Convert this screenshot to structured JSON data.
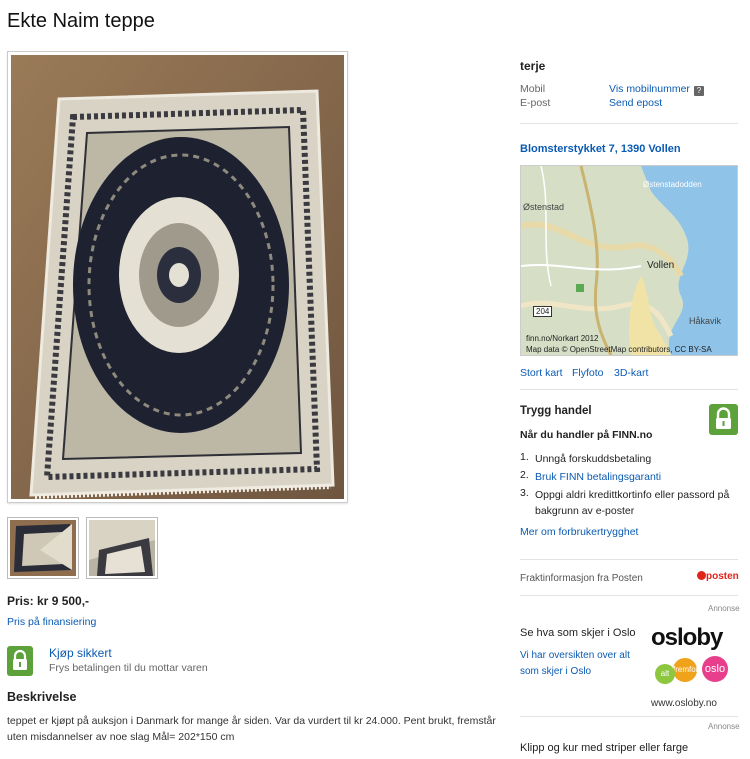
{
  "listing": {
    "title": "Ekte Naim teppe",
    "price": "Pris: kr 9 500,-",
    "financing_link": "Pris på finansiering",
    "buy_safe": {
      "title": "Kjøp sikkert",
      "subtitle": "Frys betalingen til du mottar varen"
    },
    "description_heading": "Beskrivelse",
    "description": "teppet er kjøpt på auksjon i Danmark for mange år siden. Var da vurdert til kr 24.000. Pent brukt, fremstår uten misdannelser av noe slag Mål= 202*150 cm"
  },
  "seller": {
    "name": "terje",
    "mobile_label": "Mobil",
    "mobile_link": "Vis mobilnummer",
    "email_label": "E-post",
    "email_link": "Send epost"
  },
  "location": {
    "address": "Blomsterstykket 7, 1390 Vollen",
    "map_labels": [
      "Østenstadodden",
      "Østenstad",
      "Vollen",
      "Håkavik",
      "204"
    ],
    "attribution_1": "finn.no/Norkart 2012",
    "attribution_2": "Map data © OpenStreetMap contributors, CC BY-SA",
    "links": [
      "Stort kart",
      "Flyfoto",
      "3D-kart"
    ]
  },
  "safe_trade": {
    "heading": "Trygg handel",
    "subheading": "Når du handler på FINN.no",
    "items": [
      {
        "num": "1.",
        "text": "Unngå forskuddsbetaling"
      },
      {
        "num": "2.",
        "text": "Bruk FINN betalingsgaranti"
      },
      {
        "num": "3.",
        "text": "Oppgi aldri kredittkortinfo eller passord på bakgrunn av e-poster"
      }
    ],
    "consumer_link": "Mer om forbrukertrygghet"
  },
  "freight": {
    "text": "Fraktinformasjon fra Posten",
    "logo": "posten"
  },
  "ads": {
    "label": "Annonse",
    "oslo_heading": "Se hva som skjer i Oslo",
    "oslo_text": "Vi har oversikten over alt som skjer i Oslo",
    "osloby_logo": "osloby",
    "osloby_bubbles": [
      "alt",
      "fremfor",
      "oslo"
    ],
    "osloby_url": "www.osloby.no",
    "clip_text": "Klipp og kur med striper eller farge"
  },
  "colors": {
    "link": "#0b5bb3",
    "green": "#5ca13a",
    "posten_red": "#e2231a"
  }
}
